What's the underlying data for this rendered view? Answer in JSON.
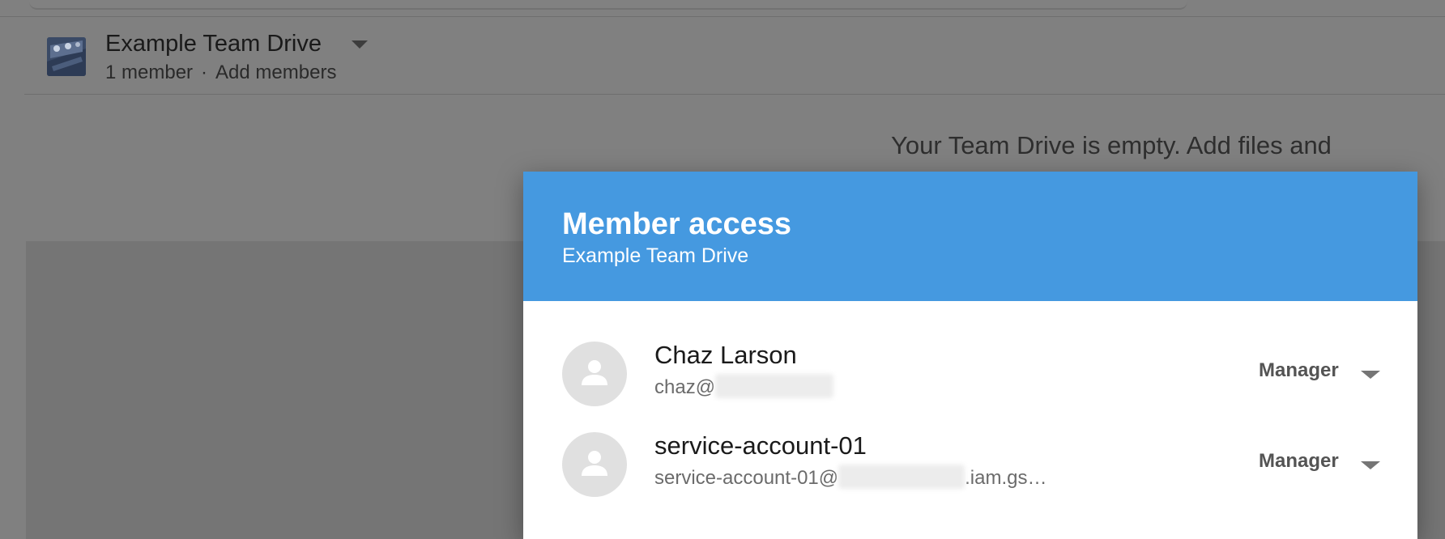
{
  "drive": {
    "title": "Example Team Drive",
    "member_count": "1 member",
    "separator": "·",
    "add_members": "Add members",
    "empty_message": "Your Team Drive is empty. Add files and"
  },
  "dialog": {
    "title": "Member access",
    "subtitle": "Example Team Drive",
    "header_color": "#4599e0",
    "members": [
      {
        "name": "Chaz Larson",
        "email_prefix": "chaz@",
        "email_suffix": "",
        "role": "Manager"
      },
      {
        "name": "service-account-01",
        "email_prefix": "service-account-01@",
        "email_suffix": ".iam.gs…",
        "role": "Manager"
      }
    ]
  }
}
